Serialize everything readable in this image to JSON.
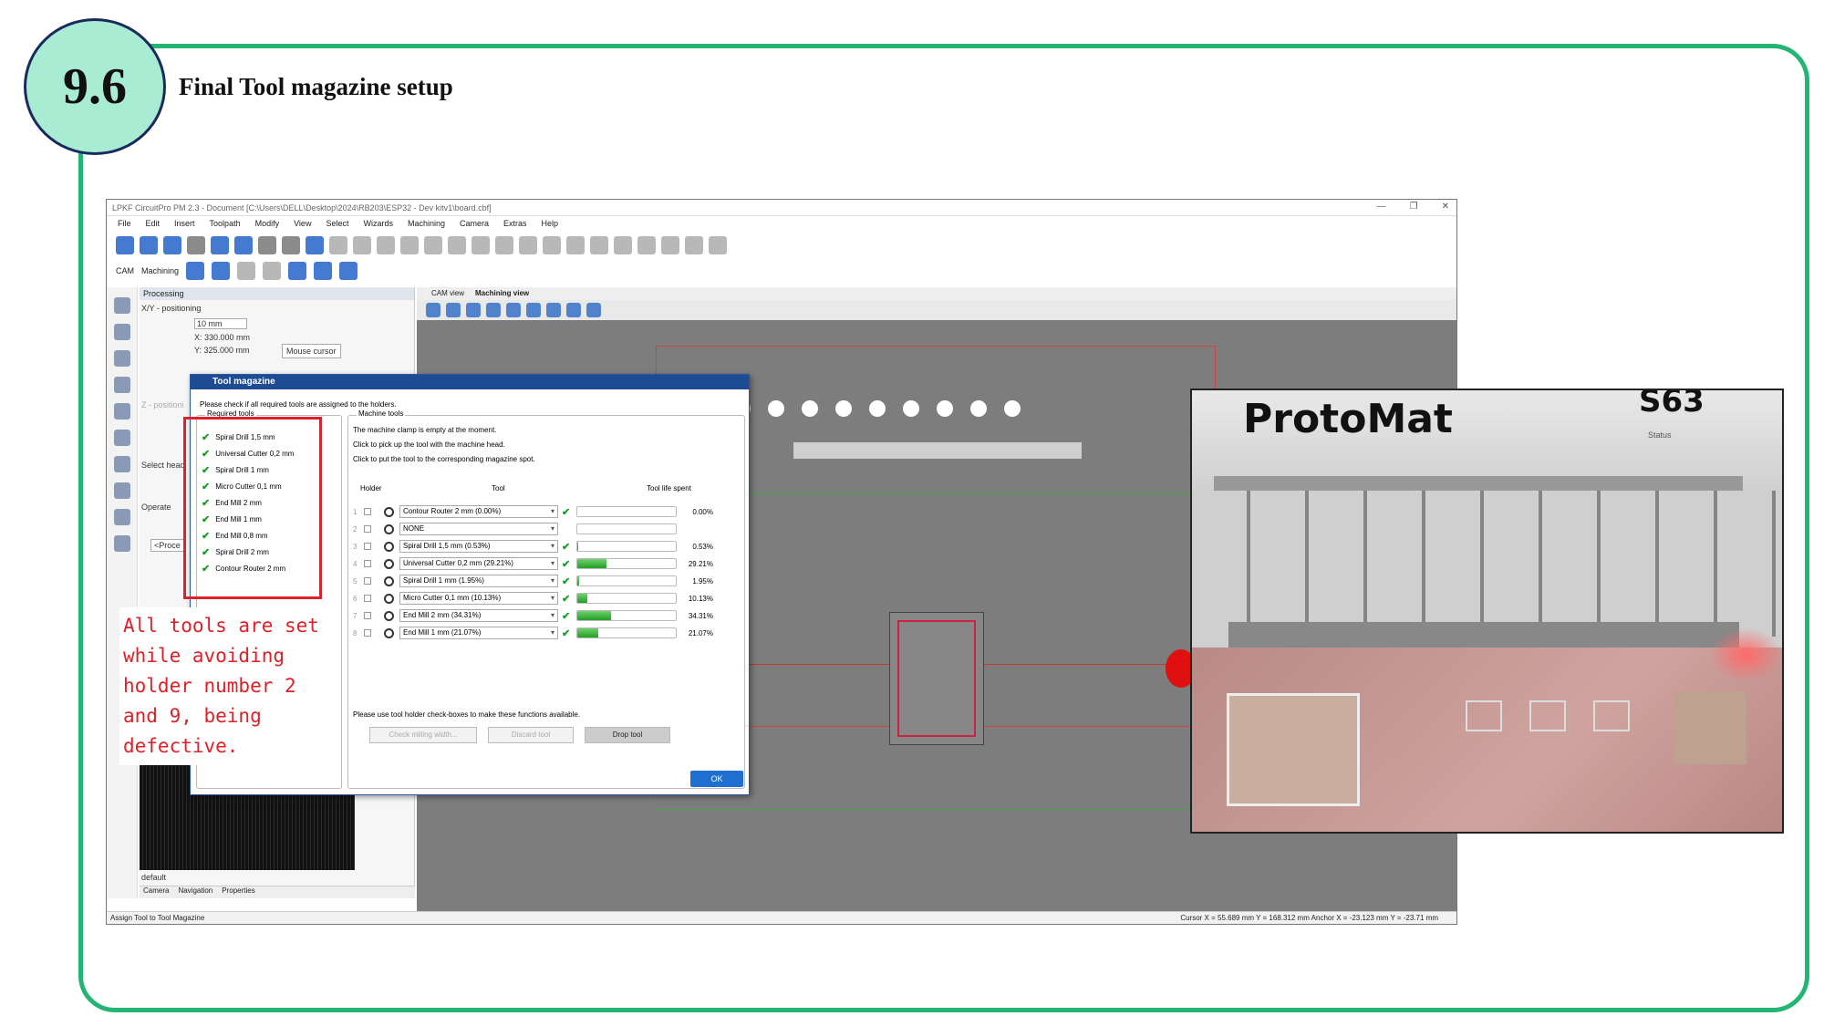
{
  "slide": {
    "section_number": "9.6",
    "section_title": "Final Tool magazine setup"
  },
  "app": {
    "title": "LPKF CircuitPro PM 2.3 - Document [C:\\Users\\DELL\\Desktop\\2024\\RB203\\ESP32 - Dev kitv1\\board.cbf]",
    "menu": [
      "File",
      "Edit",
      "Insert",
      "Toolpath",
      "Modify",
      "View",
      "Select",
      "Wizards",
      "Machining",
      "Camera",
      "Extras",
      "Help"
    ],
    "mode": {
      "cam": "CAM",
      "machining": "Machining"
    },
    "panel": {
      "title": "Processing",
      "xy_label": "X/Y - positioning",
      "step": "10 mm",
      "x_value": "330.000 mm",
      "y_value": "325.000 mm",
      "mouse_cursor": "Mouse cursor",
      "z_label": "Z - positioni",
      "select_head": "Select head",
      "operate": "Operate",
      "process_select": "<Proce",
      "camera_default": "default"
    },
    "bottom_tabs": [
      "Camera",
      "Navigation",
      "Properties"
    ],
    "view_tabs": [
      "CAM view",
      "Machining view"
    ],
    "status": {
      "left": "Assign Tool to Tool Magazine",
      "right": "Cursor X =  55.689 mm   Y =  168.312 mm        Anchor X =  -23.123 mm   Y =  -23.71 mm"
    }
  },
  "dialog": {
    "title": "Tool magazine",
    "note": "Please check if all required tools are assigned to the holders.",
    "required_label": "Required tools",
    "required_tools": [
      "Spiral Drill   1,5 mm",
      "Universal Cutter 0,2 mm",
      "Spiral Drill   1 mm",
      "Micro Cutter 0,1 mm",
      "End Mill 2 mm",
      "End Mill 1 mm",
      "End Mill 0,8 mm",
      "Spiral Drill   2 mm",
      "Contour Router 2 mm"
    ],
    "machine_label": "Machine tools",
    "machine_lines": [
      "The machine clamp is empty at the moment.",
      "Click       to pick up the tool with the machine head.",
      "Click       to put the tool to the corresponding magazine spot."
    ],
    "columns": {
      "holder": "Holder",
      "tool": "Tool",
      "life": "Tool life spent"
    },
    "rows": [
      {
        "n": "1",
        "tool": "Contour Router 2 mm (0.00%)",
        "pct": "0.00%",
        "life": 0.0,
        "ok": true
      },
      {
        "n": "2",
        "tool": "NONE",
        "pct": "",
        "life": 0.0,
        "ok": false
      },
      {
        "n": "3",
        "tool": "Spiral Drill   1,5 mm (0.53%)",
        "pct": "0.53%",
        "life": 0.0053,
        "ok": true
      },
      {
        "n": "4",
        "tool": "Universal Cutter 0,2 mm (29.21%)",
        "pct": "29.21%",
        "life": 0.2921,
        "ok": true
      },
      {
        "n": "5",
        "tool": "Spiral Drill   1 mm (1.95%)",
        "pct": "1.95%",
        "life": 0.0195,
        "ok": true
      },
      {
        "n": "6",
        "tool": "Micro Cutter 0,1 mm (10.13%)",
        "pct": "10.13%",
        "life": 0.1013,
        "ok": true
      },
      {
        "n": "7",
        "tool": "End Mill 2 mm (34.31%)",
        "pct": "34.31%",
        "life": 0.3431,
        "ok": true
      },
      {
        "n": "8",
        "tool": "End Mill 1 mm (21.07%)",
        "pct": "21.07%",
        "life": 0.2107,
        "ok": true
      }
    ],
    "footer_note": "Please use tool holder check-boxes to make these functions available.",
    "buttons": {
      "check": "Check milling width...",
      "discard": "Discard tool",
      "drop": "Drop tool",
      "ok": "OK"
    }
  },
  "annotation": {
    "text": "All tools are set while avoiding holder number 2 and 9, being defective."
  },
  "photo": {
    "brand": "ProtoMat",
    "model": "S63",
    "status": "Status"
  },
  "colors": {
    "frame": "#22b573",
    "badge_fill": "#a8ecd3",
    "annotation_red": "#e01f26",
    "dialog_title": "#1e4c94"
  }
}
